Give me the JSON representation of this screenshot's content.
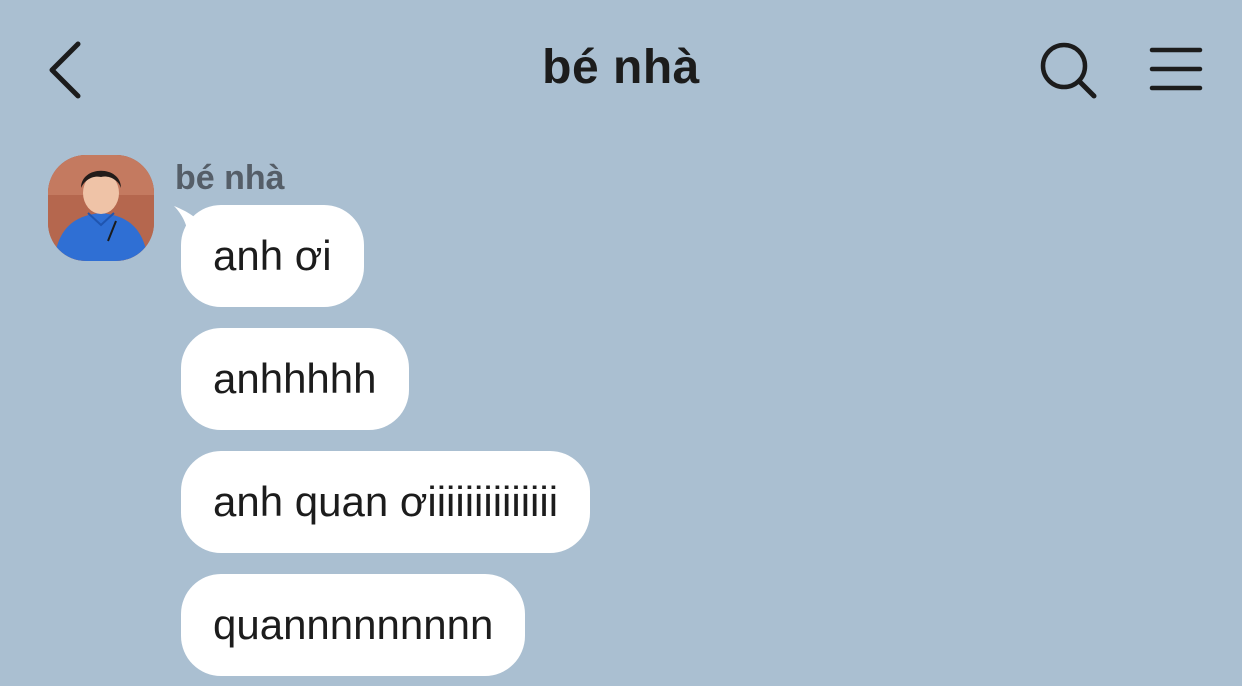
{
  "header": {
    "title": "bé nhà",
    "back_icon": "chevron-left-icon",
    "search_icon": "search-icon",
    "menu_icon": "hamburger-menu-icon"
  },
  "conversation": {
    "sender_name": "bé nhà",
    "messages": [
      {
        "text": "anh ơi"
      },
      {
        "text": "anhhhhh"
      },
      {
        "text": "anh quan ơiiiiiiiiiiiiii"
      },
      {
        "text": "quannnnnnnnn"
      }
    ]
  },
  "colors": {
    "background": "#aabfd1",
    "bubble": "#ffffff",
    "text": "#1c1c1c",
    "sender_name": "#555e68"
  }
}
